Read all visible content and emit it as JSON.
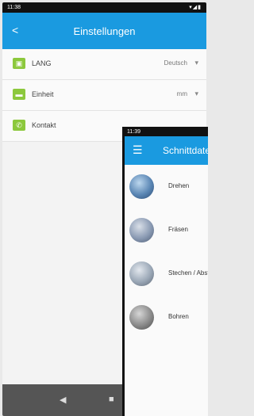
{
  "settings_phone": {
    "status_time": "11:38",
    "status_indicator": "8",
    "status_icons": "▾◢▮",
    "title": "Einstellungen",
    "rows": [
      {
        "label": "LANG",
        "value": "Deutsch",
        "icon": "language-icon"
      },
      {
        "label": "Einheit",
        "value": "mm",
        "icon": "ruler-icon"
      },
      {
        "label": "Kontakt",
        "value": "",
        "icon": "phone-icon"
      }
    ]
  },
  "tools_phone": {
    "status_time": "11:39",
    "status_indicator": "8",
    "title": "Schnittdaten",
    "tools": [
      {
        "label": "Drehen"
      },
      {
        "label": "Fräsen"
      },
      {
        "label": "Stechen / Abstechen"
      },
      {
        "label": "Bohren"
      }
    ]
  },
  "colors": {
    "appbar": "#1a9ae0",
    "row_icon": "#8cc83c",
    "navbar": "#555555"
  }
}
